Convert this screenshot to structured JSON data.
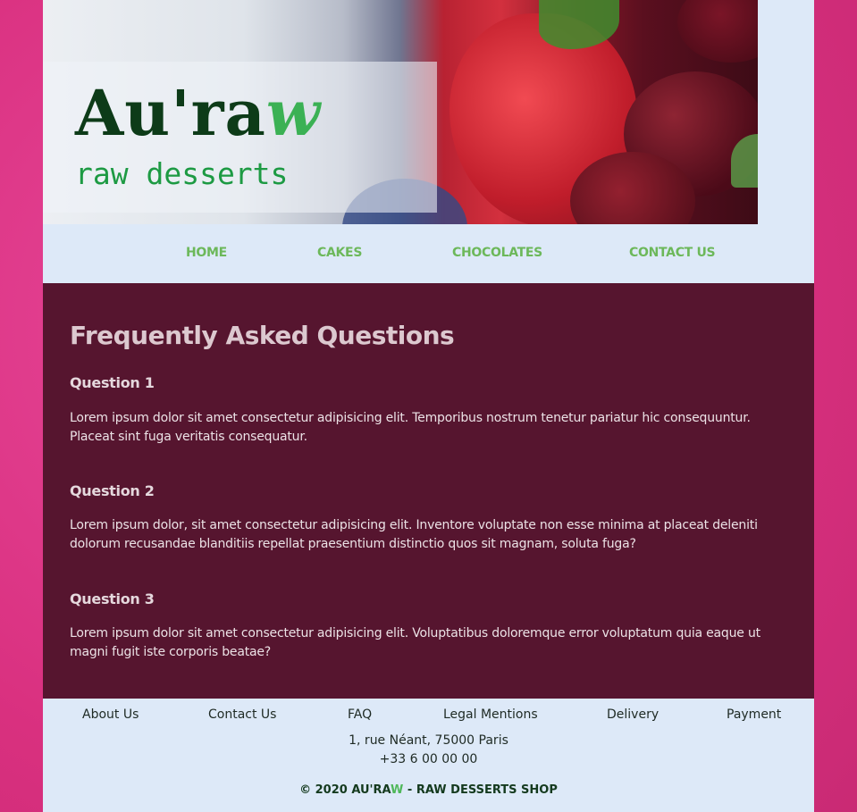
{
  "brand": {
    "logo_main": "Au'ra",
    "logo_accent": "w",
    "tagline": "raw desserts"
  },
  "nav": {
    "items": [
      {
        "label": "HOME"
      },
      {
        "label": "CAKES"
      },
      {
        "label": "CHOCOLATES"
      },
      {
        "label": "CONTACT US"
      }
    ]
  },
  "faq": {
    "title": "Frequently Asked Questions",
    "questions": [
      {
        "title": "Question 1",
        "text": "Lorem ipsum dolor sit amet consectetur adipisicing elit. Temporibus nostrum tenetur pariatur hic consequuntur. Placeat sint fuga veritatis consequatur."
      },
      {
        "title": "Question 2",
        "text": "Lorem ipsum dolor, sit amet consectetur adipisicing elit. Inventore voluptate non esse minima at placeat deleniti dolorum recusandae blanditiis repellat praesentium distinctio quos sit magnam, soluta fuga?"
      },
      {
        "title": "Question 3",
        "text": "Lorem ipsum dolor sit amet consectetur adipisicing elit. Voluptatibus doloremque error voluptatum quia eaque ut magni fugit iste corporis beatae?"
      }
    ]
  },
  "footer": {
    "links": [
      {
        "label": "About Us"
      },
      {
        "label": "Contact Us"
      },
      {
        "label": "FAQ"
      },
      {
        "label": "Legal Mentions"
      },
      {
        "label": "Delivery"
      },
      {
        "label": "Payment"
      }
    ],
    "address": "1, rue Néant, 75000 Paris",
    "phone": "+33 6 00 00 00",
    "copyright_prefix": "© 2020 AU'RA",
    "copyright_accent": "W",
    "copyright_suffix": " - RAW DESSERTS SHOP"
  },
  "colors": {
    "background": "#d9307f",
    "page": "#dde9f8",
    "main": "#56152f",
    "nav_text": "#6cb85a",
    "logo_dark": "#0d3b18",
    "logo_accent": "#3bb154"
  }
}
